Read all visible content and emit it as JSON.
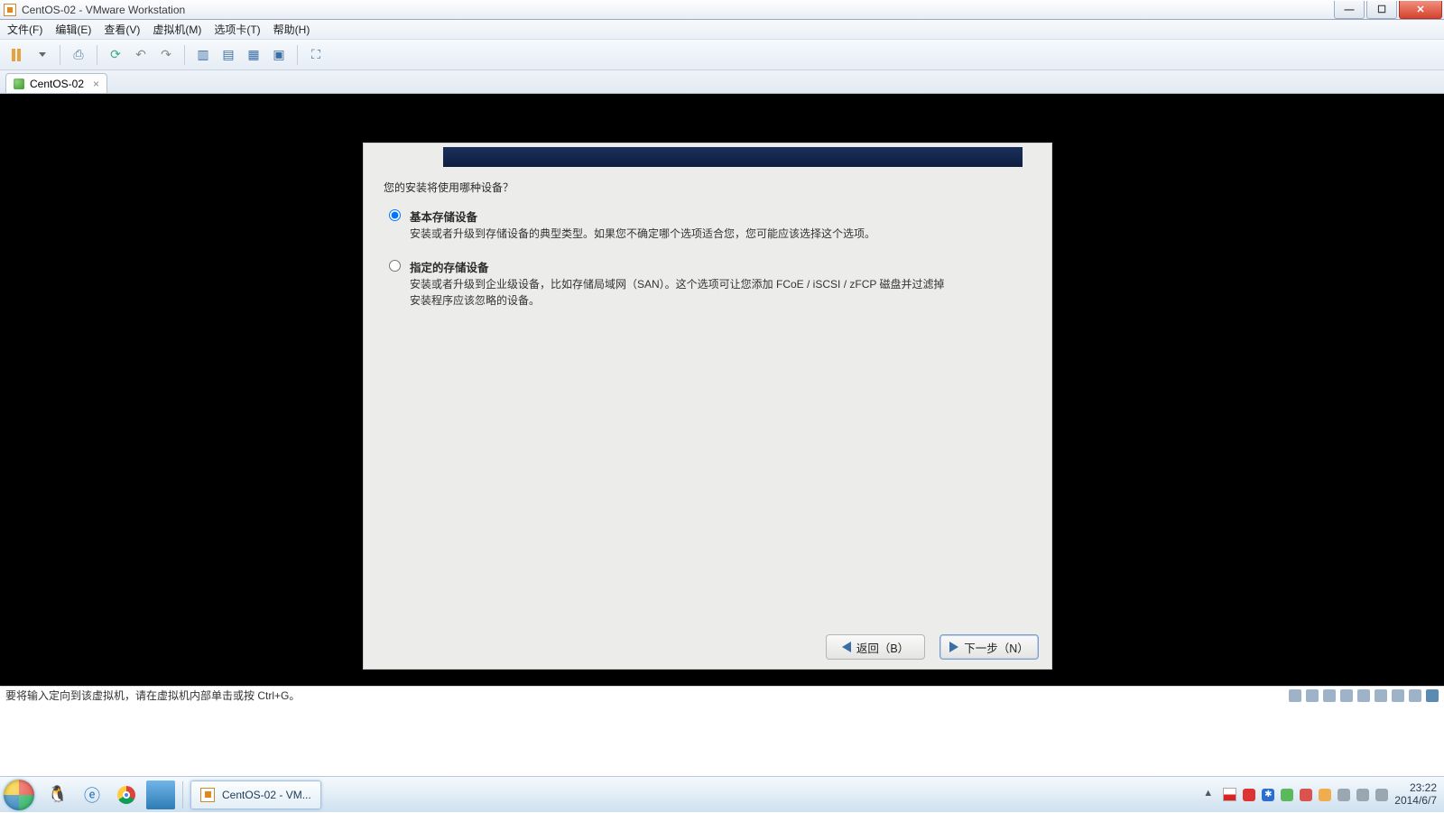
{
  "window": {
    "title": "CentOS-02 - VMware Workstation"
  },
  "menubar": {
    "file": "文件(F)",
    "edit": "编辑(E)",
    "view": "查看(V)",
    "vm": "虚拟机(M)",
    "tabs": "选项卡(T)",
    "help": "帮助(H)"
  },
  "tab": {
    "label": "CentOS-02"
  },
  "installer": {
    "question": "您的安装将使用哪种设备？",
    "opt1_title": "基本存储设备",
    "opt1_desc": "安装或者升级到存储设备的典型类型。如果您不确定哪个选项适合您，您可能应该选择这个选项。",
    "opt2_title": "指定的存储设备",
    "opt2_desc": "安装或者升级到企业级设备，比如存储局域网（SAN）。这个选项可让您添加 FCoE / iSCSI / zFCP 磁盘并过滤掉安装程序应该忽略的设备。",
    "back_label": "返回（B）",
    "next_label": "下一步（N）"
  },
  "statusbar": {
    "hint": "要将输入定向到该虚拟机，请在虚拟机内部单击或按 Ctrl+G。"
  },
  "taskbar": {
    "task_label": "CentOS-02 - VM...",
    "clock_time": "23:22",
    "clock_date": "2014/6/7"
  }
}
